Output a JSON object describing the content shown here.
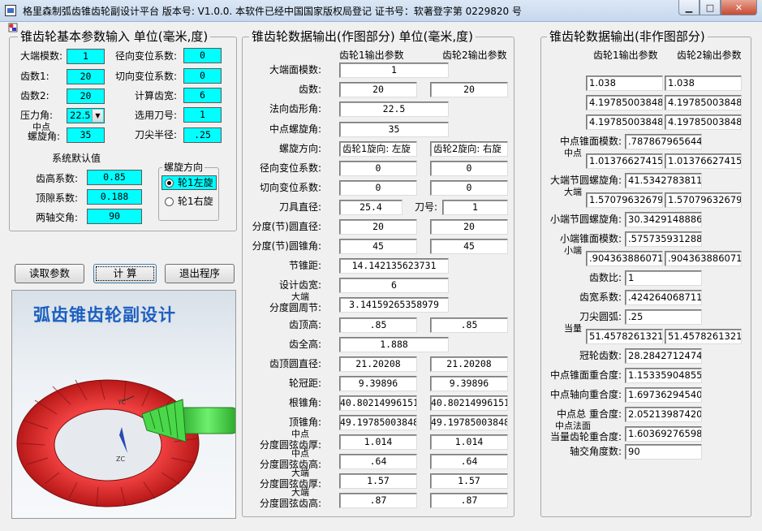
{
  "window": {
    "title": "格里森制弧齿锥齿轮副设计平台 版本号: V1.0.0.  本软件已经中国国家版权局登记  证书号：软著登字第 0229820 号"
  },
  "input_panel": {
    "title": "锥齿轮基本参数输入  单位(毫米,度)",
    "fields": [
      {
        "label": "大端模数:",
        "value": "1"
      },
      {
        "label": "径向变位系数:",
        "value": "0"
      },
      {
        "label": "齿数1:",
        "value": "20"
      },
      {
        "label": "切向变位系数:",
        "value": "0"
      },
      {
        "label": "齿数2:",
        "value": "20"
      },
      {
        "label": "计算齿宽:",
        "value": "6"
      },
      {
        "label": "压力角:",
        "value": "22.5"
      },
      {
        "label": "选用刀号:",
        "value": "1"
      },
      {
        "label1": "中点",
        "label2": "螺旋角:",
        "value": "35"
      },
      {
        "label": "刀尖半径:",
        "value": ".25"
      }
    ],
    "defaults_title": "系统默认值",
    "defaults": [
      {
        "label": "齿高系数:",
        "value": "0.85"
      },
      {
        "label": "顶隙系数:",
        "value": "0.188"
      },
      {
        "label": "两轴交角:",
        "value": "90"
      }
    ],
    "spiral": {
      "title": "螺旋方向",
      "left": "轮1左旋",
      "right": "轮1右旋"
    }
  },
  "buttons": {
    "read": "读取参数",
    "calc": "计  算",
    "exit": "退出程序"
  },
  "picture": {
    "title": "弧齿锥齿轮副设计",
    "label_yc": "YC",
    "label_zc": "ZC"
  },
  "drawing_panel": {
    "title": "锥齿轮数据输出(作图部分)  单位(毫米,度)",
    "col1": "齿轮1输出参数",
    "col2": "齿轮2输出参数",
    "rows": [
      {
        "label": "大端面模数:",
        "v1": "1",
        "wide": true
      },
      {
        "label": "齿数:",
        "v1": "20",
        "v2": "20"
      },
      {
        "label": "法向齿形角:",
        "v1": "22.5",
        "wide": true
      },
      {
        "label": "中点螺旋角:",
        "v1": "35",
        "wide": true
      },
      {
        "label": "螺旋方向:",
        "v1": "齿轮1旋向: 左旋",
        "v2": "齿轮2旋向: 右旋",
        "text": true
      },
      {
        "label": "径向变位系数:",
        "v1": "0",
        "v2": "0"
      },
      {
        "label": "切向变位系数:",
        "v1": "0",
        "v2": "0"
      },
      {
        "label": "刀具直径:",
        "v1": "25.4",
        "label2": "刀号:",
        "v2": "1"
      },
      {
        "label": "分度(节)圆直径:",
        "v1": "20",
        "v2": "20"
      },
      {
        "label": "分度(节)圆锥角:",
        "v1": "45",
        "v2": "45"
      },
      {
        "label": "节锥距:",
        "v1": "14.142135623731",
        "wide": true
      },
      {
        "label": "设计齿宽:",
        "v1": "6",
        "wide": true
      },
      {
        "label1": "大端",
        "label": "分度圆周节:",
        "v1": "3.14159265358979",
        "wide": true
      },
      {
        "label": "齿顶高:",
        "v1": ".85",
        "v2": ".85"
      },
      {
        "label": "齿全高:",
        "v1": "1.888",
        "wide": true
      },
      {
        "label": "齿顶圆直径:",
        "v1": "21.20208",
        "v2": "21.20208"
      },
      {
        "label": "轮冠距:",
        "v1": "9.39896",
        "v2": "9.39896"
      },
      {
        "label": "根锥角:",
        "v1": "40.8021499615129",
        "v2": "40.8021499615129"
      },
      {
        "label": "顶锥角:",
        "v1": "49.1978500384871",
        "v2": "49.1978500384871"
      },
      {
        "label1": "中点",
        "label": "分度圆弦齿厚:",
        "v1": "1.014",
        "v2": "1.014"
      },
      {
        "label1": "中点",
        "label": "分度圆弦齿高:",
        "v1": ".64",
        "v2": ".64"
      },
      {
        "label1": "大端",
        "label": "分度圆弦齿厚:",
        "v1": "1.57",
        "v2": "1.57"
      },
      {
        "label1": "大端",
        "label": "分度圆弦齿高:",
        "v1": ".87",
        "v2": ".87"
      }
    ]
  },
  "other_panel": {
    "title": "锥齿轮数据输出(非作图部分)",
    "col1": "齿轮1输出参数",
    "col2": "齿轮2输出参数",
    "rows": [
      {
        "label": "齿根高:",
        "v1": "1.038",
        "v2": "1.038"
      },
      {
        "label": "齿顶角:",
        "v1": "4.19785003848751",
        "v2": "4.19785003848751"
      },
      {
        "label": "齿根角:",
        "v1": "4.19785003848751",
        "v2": "4.19785003848751"
      },
      {
        "label": "中点锥面模数:",
        "v1": ".787867965644036"
      },
      {
        "label1": "中点",
        "label": "弧齿厚:",
        "v1": "1.013766274156",
        "v2": "1.013766274156"
      },
      {
        "label": "大端节圆螺旋角:",
        "v1": "41.534278381157"
      },
      {
        "label1": "大端",
        "label": "弧齿厚:",
        "v1": "1.5707963267949",
        "v2": "1.5707963267949"
      },
      {
        "label": "小端节圆螺旋角:",
        "v1": "30.342914888674"
      },
      {
        "label": "小端锥面模数:",
        "v1": ".575735931288071"
      },
      {
        "label1": "小端",
        "label": "弧齿厚:",
        "v1": ".904363886071148",
        "v2": ".904363886071148"
      },
      {
        "label": "齿数比:",
        "v1": "1"
      },
      {
        "label": "齿宽系数:",
        "v1": ".424264068711928"
      },
      {
        "label": "刀尖圆弧:",
        "v1": ".25"
      },
      {
        "label1": "当量",
        "label": "齿数:",
        "v1": "51.4578261321351",
        "v2": "51.4578261321351"
      },
      {
        "label": "冠轮齿数:",
        "v1": "28.2842712474619"
      },
      {
        "label": "中点锥面重合度:",
        "v1": "1.15335904855570"
      },
      {
        "label": "中点轴向重合度:",
        "v1": "1.69736294540447"
      },
      {
        "label": "中点总  重合度:",
        "v1": "2.05213987420877"
      },
      {
        "label1": "中点法面",
        "label": "当量齿轮重合度:",
        "v1": "1.60369276598965"
      },
      {
        "label": "轴交角度数:",
        "v1": "90"
      }
    ]
  },
  "colors": {
    "field_highlight": "#00ffff",
    "picture_title": "#1c5fc0",
    "gear_red": "#e52b2b",
    "pinion_green": "#3fcf3f"
  }
}
